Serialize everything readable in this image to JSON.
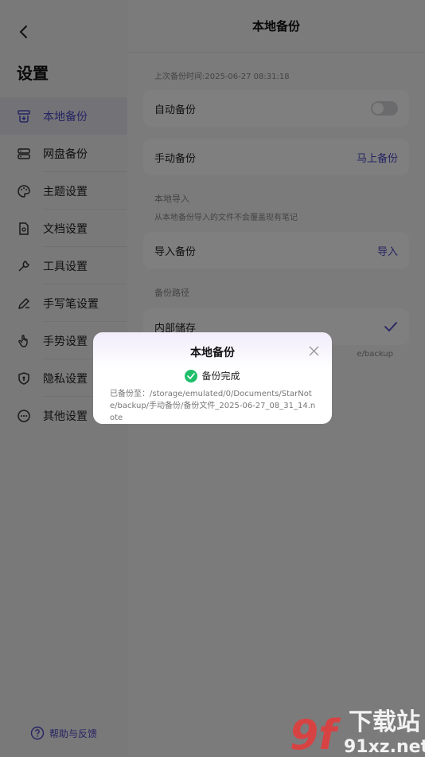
{
  "sidebar": {
    "title": "设置",
    "items": [
      {
        "label": "本地备份",
        "icon": "local-backup-icon",
        "active": true
      },
      {
        "label": "网盘备份",
        "icon": "cloud-drive-icon"
      },
      {
        "label": "主题设置",
        "icon": "palette-icon"
      },
      {
        "label": "文档设置",
        "icon": "document-icon"
      },
      {
        "label": "工具设置",
        "icon": "wrench-icon"
      },
      {
        "label": "手写笔设置",
        "icon": "pen-icon"
      },
      {
        "label": "手势设置",
        "icon": "hand-icon"
      },
      {
        "label": "隐私设置",
        "icon": "shield-icon"
      },
      {
        "label": "其他设置",
        "icon": "more-icon"
      }
    ],
    "help_label": "帮助与反馈"
  },
  "main": {
    "title": "本地备份",
    "last_backup": "上次备份时间:2025-06-27 08:31:18",
    "auto_backup_label": "自动备份",
    "manual_backup_label": "手动备份",
    "manual_backup_action": "马上备份",
    "import_section": "本地导入",
    "import_note": "从本地备份导入的文件不会覆盖现有笔记",
    "import_label": "导入备份",
    "import_action": "导入",
    "path_section": "备份路径",
    "storage_label": "内部储存",
    "path_note": "e/backup"
  },
  "dialog": {
    "title": "本地备份",
    "status": "备份完成",
    "message": "已备份至：/storage/emulated/0/Documents/StarNote/backup/手动备份/备份文件_2025-06-27_08_31_14.note"
  },
  "watermark": {
    "text_top": "下载站",
    "text_bottom": "91xz.net",
    "logo": "9f"
  },
  "colors": {
    "accent": "#4c48c6",
    "success": "#1fbf6a"
  }
}
